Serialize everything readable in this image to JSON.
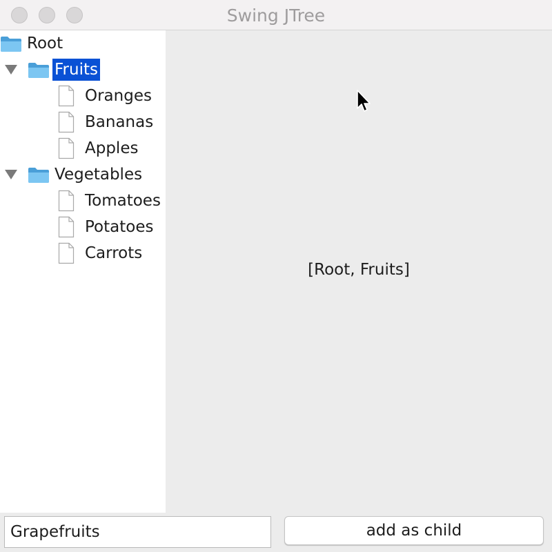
{
  "window": {
    "title": "Swing JTree"
  },
  "tree": {
    "root": {
      "label": "Root",
      "icon": "folder-icon"
    },
    "groups": [
      {
        "label": "Fruits",
        "expanded": true,
        "selected": true,
        "icon": "folder-icon",
        "children": [
          "Oranges",
          "Bananas",
          "Apples"
        ]
      },
      {
        "label": "Vegetables",
        "expanded": true,
        "selected": false,
        "icon": "folder-icon",
        "children": [
          "Tomatoes",
          "Potatoes",
          "Carrots"
        ]
      }
    ]
  },
  "detail": {
    "selection_path": "[Root, Fruits]"
  },
  "form": {
    "input_value": "Grapefruits",
    "add_button_label": "add as child"
  },
  "colors": {
    "selection": "#0a51d5",
    "folder": "#6ab8ec"
  }
}
